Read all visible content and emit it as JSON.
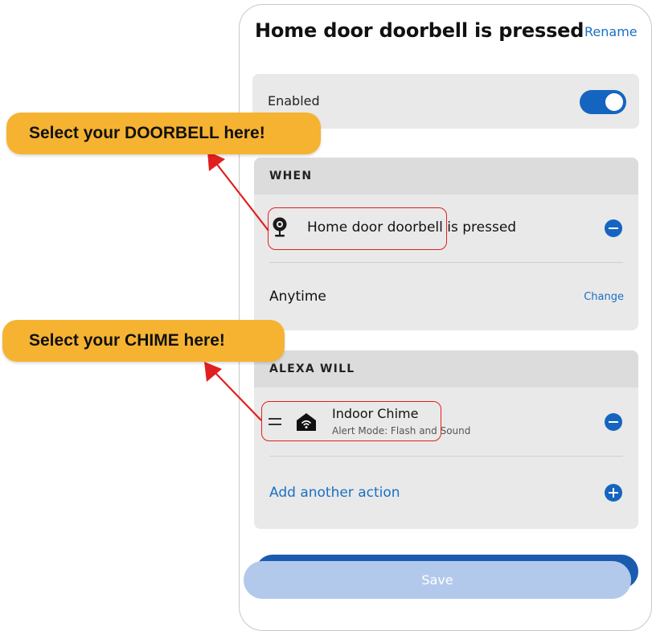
{
  "header": {
    "title": "Home door doorbell is pressed",
    "rename_label": "Rename"
  },
  "enabled": {
    "label": "Enabled",
    "on": true
  },
  "when": {
    "heading": "WHEN",
    "trigger_device": "Home door doorbell",
    "trigger_suffix": "is pressed",
    "schedule": "Anytime",
    "change_label": "Change"
  },
  "alexa_will": {
    "heading": "ALEXA WILL",
    "action_title": "Indoor Chime",
    "action_subtitle": "Alert Mode: Flash and Sound",
    "add_label": "Add another action"
  },
  "save_label": "Save",
  "callouts": {
    "doorbell": "Select your DOORBELL here!",
    "chime": "Select your CHIME here!"
  },
  "colors": {
    "accent": "#1565c0",
    "callout": "#f6b331",
    "annotation": "#e02020"
  },
  "icons": [
    "camera-doorbell-icon",
    "smart-home-icon",
    "drag-handle-icon",
    "minus-circle-icon",
    "plus-circle-icon"
  ]
}
